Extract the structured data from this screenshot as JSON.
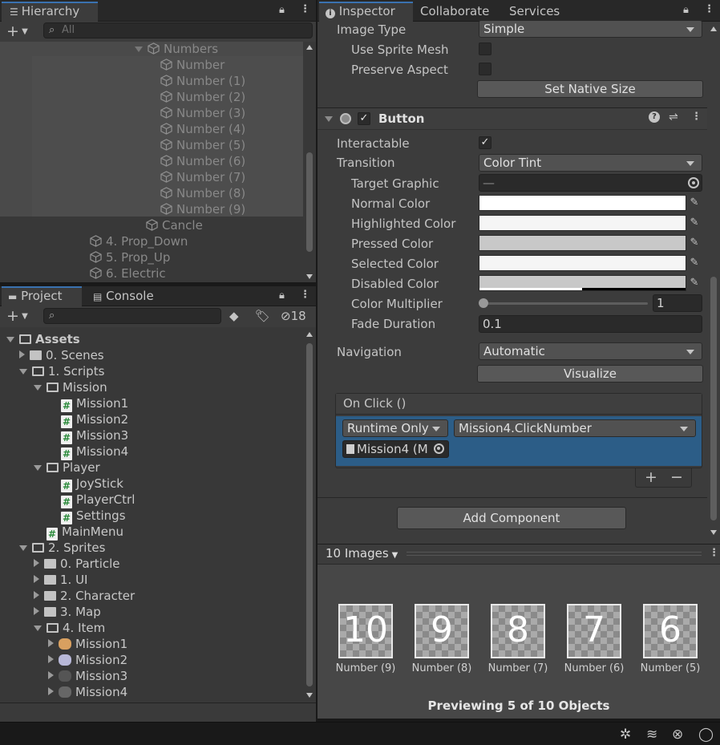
{
  "hierarchy": {
    "tab": "Hierarchy",
    "search_placeholder": "All",
    "items": [
      {
        "label": "Numbers",
        "level": 0
      },
      {
        "label": "Number"
      },
      {
        "label": "Number (1)"
      },
      {
        "label": "Number (2)"
      },
      {
        "label": "Number (3)"
      },
      {
        "label": "Number (4)"
      },
      {
        "label": "Number (5)"
      },
      {
        "label": "Number (6)"
      },
      {
        "label": "Number (7)"
      },
      {
        "label": "Number (8)"
      },
      {
        "label": "Number (9)"
      },
      {
        "label": "Cancle"
      },
      {
        "label": "4. Prop_Down"
      },
      {
        "label": "5. Prop_Up"
      },
      {
        "label": "6. Electric"
      }
    ]
  },
  "project": {
    "tab_project": "Project",
    "tab_console": "Console",
    "hidden_count": "18",
    "tree": [
      {
        "label": "Assets"
      },
      {
        "label": "0. Scenes"
      },
      {
        "label": "1. Scripts"
      },
      {
        "label": "Mission"
      },
      {
        "label": "Mission1"
      },
      {
        "label": "Mission2"
      },
      {
        "label": "Mission3"
      },
      {
        "label": "Mission4"
      },
      {
        "label": "Player"
      },
      {
        "label": "JoyStick"
      },
      {
        "label": "PlayerCtrl"
      },
      {
        "label": "Settings"
      },
      {
        "label": "MainMenu"
      },
      {
        "label": "2. Sprites"
      },
      {
        "label": "0. Particle"
      },
      {
        "label": "1. UI"
      },
      {
        "label": "2. Character"
      },
      {
        "label": "3. Map"
      },
      {
        "label": "4. Item"
      },
      {
        "label": "Mission1"
      },
      {
        "label": "Mission2"
      },
      {
        "label": "Mission3"
      },
      {
        "label": "Mission4"
      }
    ]
  },
  "inspector": {
    "tabs": [
      "Inspector",
      "Collaborate",
      "Services"
    ],
    "image_type_label": "Image Type",
    "image_type_value": "Simple",
    "use_sprite_mesh": "Use Sprite Mesh",
    "preserve_aspect": "Preserve Aspect",
    "set_native_size": "Set Native Size",
    "button_component": "Button",
    "interactable": "Interactable",
    "transition_label": "Transition",
    "transition_value": "Color Tint",
    "target_graphic": "Target Graphic",
    "target_graphic_value": "—",
    "normal_color": "Normal Color",
    "highlighted_color": "Highlighted Color",
    "pressed_color": "Pressed Color",
    "selected_color": "Selected Color",
    "disabled_color": "Disabled Color",
    "color_multiplier": "Color Multiplier",
    "color_multiplier_value": "1",
    "color_multiplier_level": 0,
    "fade_duration": "Fade Duration",
    "fade_duration_value": "0.1",
    "navigation_label": "Navigation",
    "navigation_value": "Automatic",
    "visualize": "Visualize",
    "on_click": "On Click ()",
    "runtime": "Runtime Only",
    "method": "Mission4.ClickNumber",
    "object": "Mission4 (M",
    "add_component": "Add Component",
    "colors": {
      "normal": "#ffffff",
      "highlighted": "#f5f5f5",
      "pressed": "#c8c8c8",
      "selected": "#f5f5f5",
      "disabled": "#c8c8c8",
      "accent": "#2c5d87"
    }
  },
  "preview": {
    "header": "10 Images",
    "items": [
      {
        "digit": "10",
        "name": "Number (9)"
      },
      {
        "digit": "9",
        "name": "Number (8)"
      },
      {
        "digit": "8",
        "name": "Number (7)"
      },
      {
        "digit": "7",
        "name": "Number (6)"
      },
      {
        "digit": "6",
        "name": "Number (5)"
      }
    ],
    "footer": "Previewing 5 of 10 Objects"
  }
}
